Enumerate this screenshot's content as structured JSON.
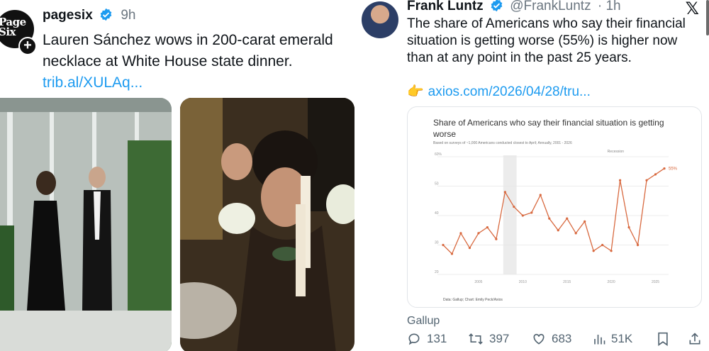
{
  "left_post": {
    "brand_logo_text": "Page Six",
    "account_name": "pagesix",
    "time": "9h",
    "text": "Lauren Sánchez wows in 200-carat emerald necklace at White House state dinner. ",
    "link": "trib.al/XULAq..."
  },
  "right_post": {
    "name": "Frank Luntz",
    "handle": "@FrankLuntz",
    "time": "· 1h",
    "text": "The share of Americans who say their financial situation is getting worse (55%) is higher now than at any point in the past 25 years.",
    "link_text": "axios.com/2026/04/28/tru...",
    "footer_label": "Gallup",
    "stats": {
      "replies": "131",
      "reposts": "397",
      "likes": "683",
      "views": "51K"
    }
  },
  "chart_data": {
    "type": "line",
    "title": "Share of Americans who say their financial situation is getting worse",
    "subtitle": "Based on surveys of ~1,000 Americans conducted closest to April; Annually, 2001 - 2026",
    "source": "Data: Gallup; Chart: Emily Peck/Axios",
    "annotation": "Recession",
    "end_label": "55%",
    "x": [
      2001,
      2002,
      2003,
      2004,
      2005,
      2006,
      2007,
      2008,
      2009,
      2010,
      2011,
      2012,
      2013,
      2014,
      2015,
      2016,
      2017,
      2018,
      2019,
      2020,
      2021,
      2022,
      2023,
      2024,
      2025,
      2026
    ],
    "values": [
      30,
      27,
      34,
      29,
      34,
      36,
      32,
      48,
      43,
      40,
      41,
      47,
      39,
      35,
      39,
      34,
      38,
      28,
      30,
      28,
      52,
      36,
      30,
      52,
      54,
      56
    ],
    "xticks": [
      "2005",
      "2010",
      "2015",
      "2020",
      "2025"
    ],
    "yticks": [
      "20",
      "30",
      "40",
      "50",
      "60%"
    ],
    "ylim": [
      20,
      60
    ],
    "color": "#d8693f"
  }
}
